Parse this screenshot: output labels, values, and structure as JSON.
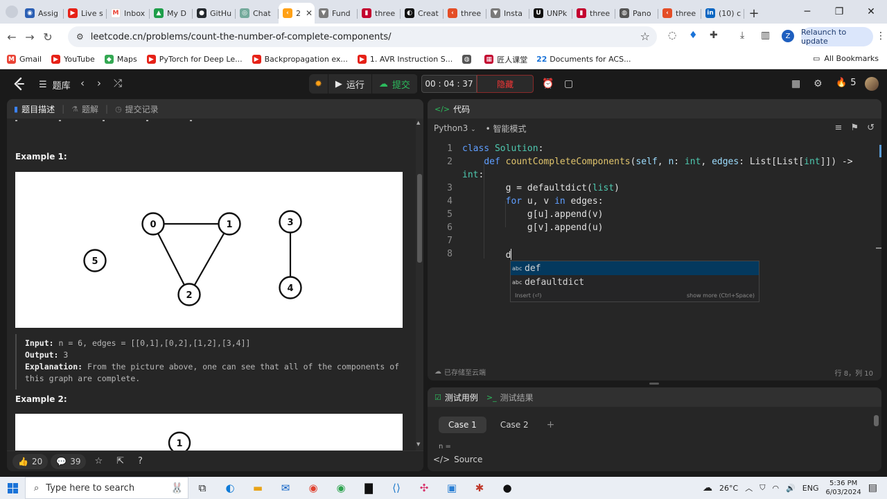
{
  "browser": {
    "tabs": [
      {
        "label": "Assig",
        "fav_color": "#2b5fb4",
        "fav_glyph": "◉"
      },
      {
        "label": "Live s",
        "fav_color": "#e62117",
        "fav_glyph": "▶"
      },
      {
        "label": "Inbox",
        "fav_color": "#ffffff",
        "fav_glyph": "M"
      },
      {
        "label": "My D",
        "fav_color": "#1e9e4a",
        "fav_glyph": "▲"
      },
      {
        "label": "GitHu",
        "fav_color": "#24292e",
        "fav_glyph": "●"
      },
      {
        "label": "Chat",
        "fav_color": "#74aa9c",
        "fav_glyph": "◎"
      },
      {
        "label": "2",
        "fav_color": "#ffa116",
        "fav_glyph": "‹"
      },
      {
        "label": "Fund",
        "fav_color": "#7a7a7a",
        "fav_glyph": "▼"
      },
      {
        "label": "three",
        "fav_color": "#c3002f",
        "fav_glyph": "▮"
      },
      {
        "label": "Creat",
        "fav_color": "#111111",
        "fav_glyph": "◐"
      },
      {
        "label": "three",
        "fav_color": "#e44d26",
        "fav_glyph": "‹"
      },
      {
        "label": "Insta",
        "fav_color": "#7a7a7a",
        "fav_glyph": "▼"
      },
      {
        "label": "UNPk",
        "fav_color": "#111111",
        "fav_glyph": "U"
      },
      {
        "label": "three",
        "fav_color": "#c3002f",
        "fav_glyph": "▮"
      },
      {
        "label": "Pano",
        "fav_color": "#555555",
        "fav_glyph": "◍"
      },
      {
        "label": "three",
        "fav_color": "#e44d26",
        "fav_glyph": "‹"
      },
      {
        "label": "(10) c",
        "fav_color": "#0a66c2",
        "fav_glyph": "in"
      }
    ],
    "active_tab_index": 6,
    "url": "leetcode.cn/problems/count-the-number-of-complete-components/",
    "relaunch_label": "Relaunch to update",
    "profile_letter": "Z",
    "bookmarks": [
      {
        "label": "Gmail",
        "fav_color": "#ea4335",
        "fav_glyph": "M"
      },
      {
        "label": "YouTube",
        "fav_color": "#e62117",
        "fav_glyph": "▶"
      },
      {
        "label": "Maps",
        "fav_color": "#34a853",
        "fav_glyph": "◆"
      },
      {
        "label": "PyTorch for Deep Le...",
        "fav_color": "#e62117",
        "fav_glyph": "▶"
      },
      {
        "label": "Backpropagation ex...",
        "fav_color": "#e62117",
        "fav_glyph": "▶"
      },
      {
        "label": "1. AVR Instruction S...",
        "fav_color": "#e62117",
        "fav_glyph": "▶"
      },
      {
        "label": "",
        "fav_color": "#555555",
        "fav_glyph": "◍"
      },
      {
        "label": "匠人课堂",
        "fav_color": "#c3002f",
        "fav_glyph": "▦"
      },
      {
        "label": "Documents for ACS...",
        "fav_color": "#1a73d8",
        "fav_glyph": "22"
      }
    ],
    "all_bookmarks_label": "All Bookmarks"
  },
  "lc_nav": {
    "problems_label": "题库",
    "run_label": "运行",
    "submit_label": "提交",
    "timer": "00 : 04 : 37",
    "hide_label": "隐藏",
    "streak_count": "5"
  },
  "left_panel": {
    "tabs": [
      {
        "label": "题目描述",
        "icon": "document-icon",
        "active": true
      },
      {
        "label": "题解",
        "icon": "flask-icon",
        "active": false
      },
      {
        "label": "提交记录",
        "icon": "history-icon",
        "active": false
      }
    ],
    "example1_title": "Example 1:",
    "example1": {
      "input_label": "Input:",
      "input_value": "n = 6, edges = [[0,1],[0,2],[1,2],[3,4]]",
      "output_label": "Output:",
      "output_value": "3",
      "explanation_label": "Explanation:",
      "explanation_value": "From the picture above, one can see that all of the components of this graph are complete."
    },
    "example2_title": "Example 2:",
    "graph1": {
      "nodes": [
        {
          "id": "0"
        },
        {
          "id": "1"
        },
        {
          "id": "2"
        },
        {
          "id": "3"
        },
        {
          "id": "4"
        },
        {
          "id": "5"
        }
      ],
      "edges": [
        [
          "0",
          "1"
        ],
        [
          "0",
          "2"
        ],
        [
          "1",
          "2"
        ],
        [
          "3",
          "4"
        ]
      ]
    },
    "graph2_visible_node": "1",
    "likes": "20",
    "comments": "39"
  },
  "code_panel": {
    "title": "代码",
    "language": "Python3",
    "mode": "智能模式",
    "lines": [
      "1",
      "2",
      "",
      "3",
      "4",
      "5",
      "6",
      "7",
      "8"
    ],
    "saved_status": "已存储至云端",
    "cursor_pos": "行 8，列 10"
  },
  "suggest": {
    "items": [
      {
        "kind": "abc",
        "text": "def",
        "selected": true
      },
      {
        "kind": "abc",
        "text": "defaultdict",
        "selected": false
      }
    ],
    "insert_hint": "Insert (⏎)",
    "more_hint": "show more (Ctrl+Space)"
  },
  "test_panel": {
    "tabs": [
      {
        "label": "测试用例",
        "active": true
      },
      {
        "label": "测试结果",
        "active": false
      }
    ],
    "cases": [
      "Case 1",
      "Case 2"
    ],
    "n_label": "n =",
    "source_label": "Source"
  },
  "taskbar": {
    "search_placeholder": "Type here to search",
    "temperature": "26°C",
    "lang": "ENG",
    "time": "5:36 PM",
    "date": "6/03/2024"
  }
}
